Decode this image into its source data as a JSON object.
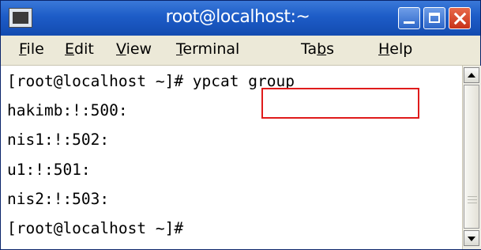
{
  "window": {
    "title": "root@localhost:~"
  },
  "menu": {
    "items": [
      {
        "prefix": "",
        "mnemonic": "F",
        "suffix": "ile"
      },
      {
        "prefix": "",
        "mnemonic": "E",
        "suffix": "dit"
      },
      {
        "prefix": "",
        "mnemonic": "V",
        "suffix": "iew"
      },
      {
        "prefix": "",
        "mnemonic": "T",
        "suffix": "erminal"
      },
      {
        "prefix": "Ta",
        "mnemonic": "b",
        "suffix": "s"
      },
      {
        "prefix": "",
        "mnemonic": "H",
        "suffix": "elp"
      }
    ]
  },
  "terminal": {
    "lines": [
      "[root@localhost ~]# ypcat group",
      "hakimb:!:500:",
      "nis1:!:502:",
      "u1:!:501:",
      "nis2:!:503:",
      "[root@localhost ~]#"
    ],
    "highlighted_command": "ypcat group",
    "highlight_color": "#e01b1b"
  },
  "colors": {
    "titlebar": "#1d5cc7",
    "menubar": "#ece9d8"
  }
}
